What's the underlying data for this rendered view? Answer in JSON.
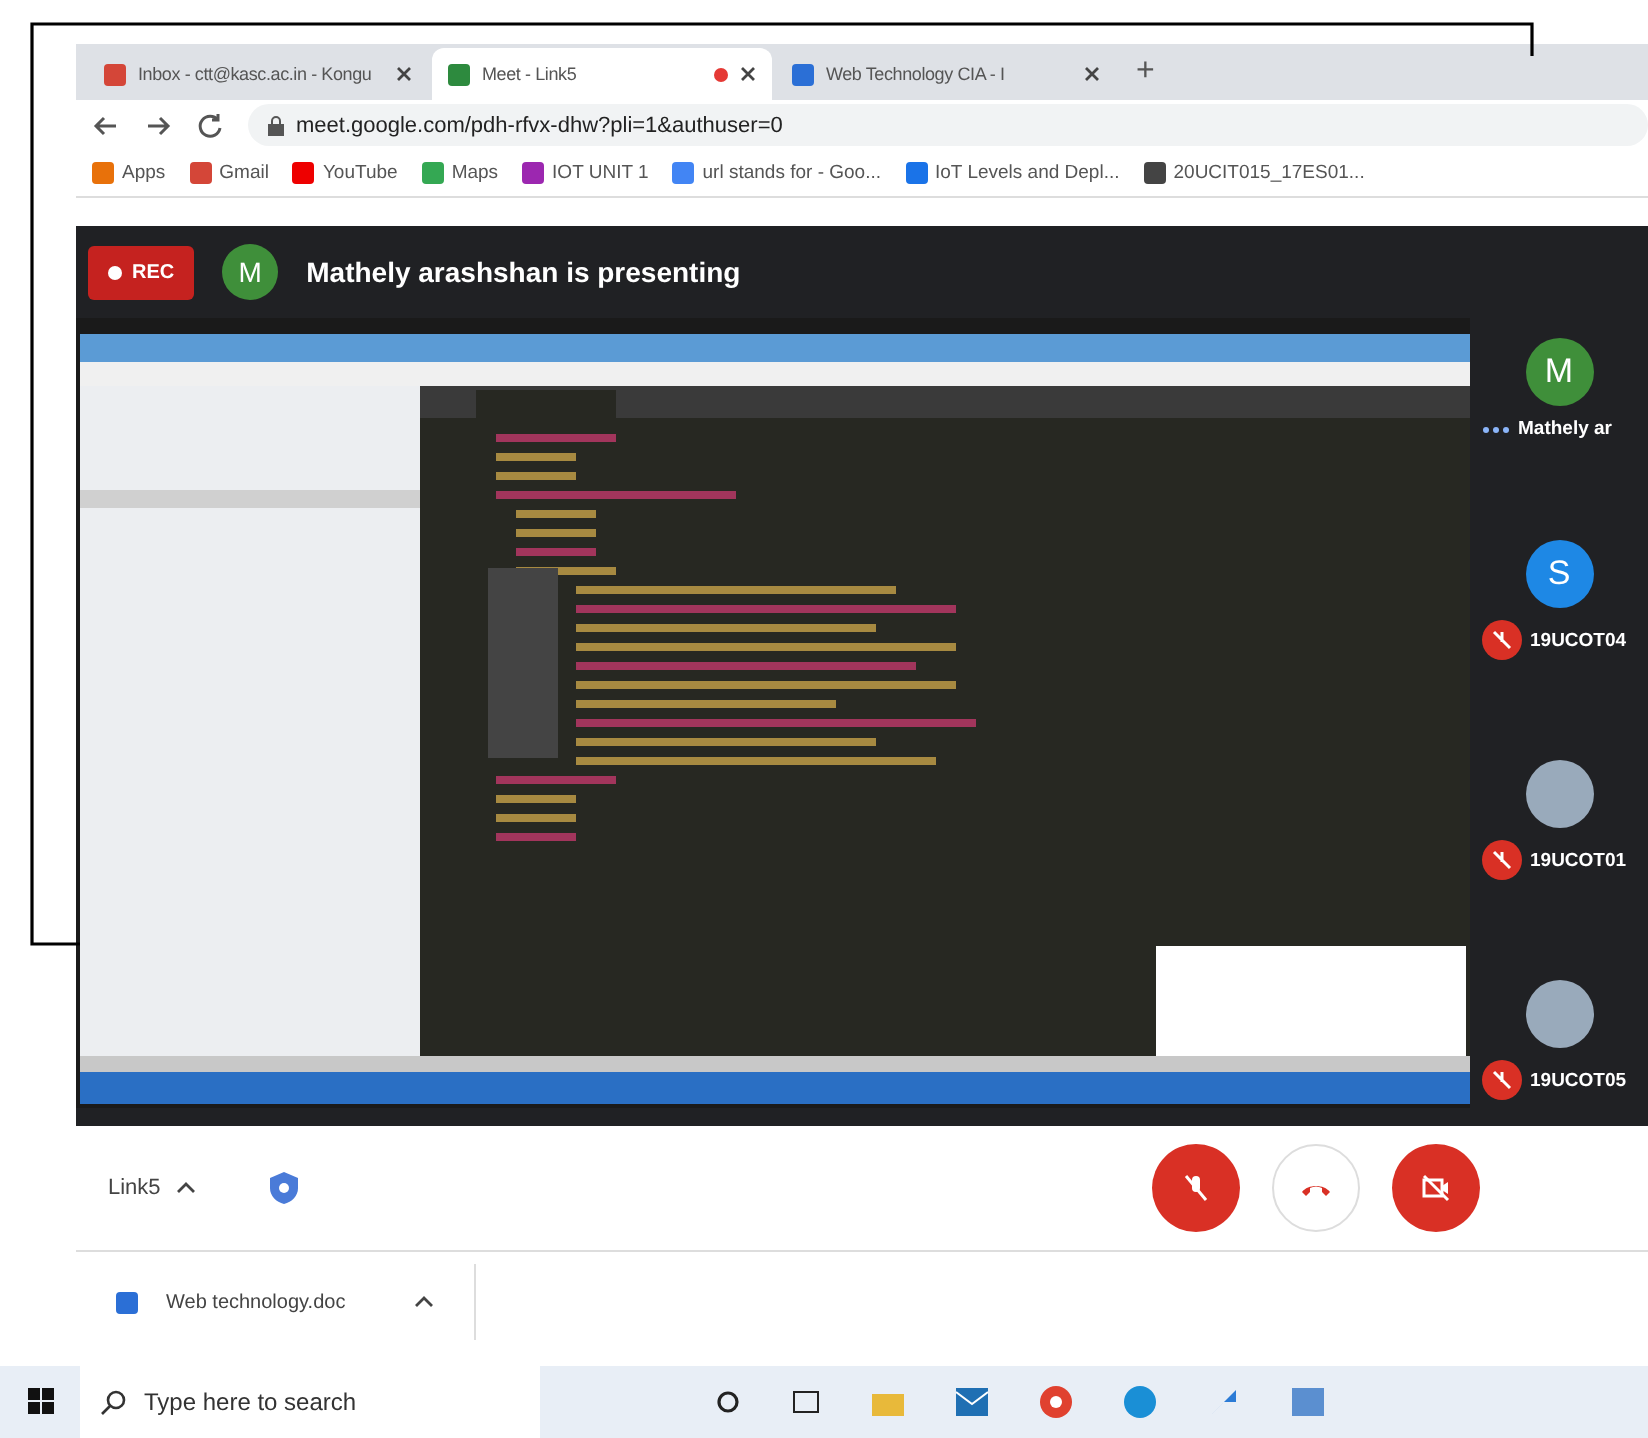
{
  "tabs": [
    {
      "title": "Inbox - ctt@kasc.ac.in - Kongu",
      "kind": "gmail",
      "selected": false,
      "recording": false
    },
    {
      "title": "Meet - Link5",
      "kind": "meet",
      "selected": true,
      "recording": true
    },
    {
      "title": "Web Technology CIA - I",
      "kind": "doc",
      "selected": false,
      "recording": false
    }
  ],
  "new_tab": "+",
  "address": "meet.google.com/pdh-rfvx-dhw?pli=1&authuser=0",
  "bookmarks": [
    {
      "label": "Apps",
      "kind": "apps"
    },
    {
      "label": "Gmail",
      "kind": "gmail"
    },
    {
      "label": "YouTube",
      "kind": "youtube"
    },
    {
      "label": "Maps",
      "kind": "maps"
    },
    {
      "label": "IOT UNIT 1",
      "kind": "wave"
    },
    {
      "label": "url stands for - Goo...",
      "kind": "google"
    },
    {
      "label": "IoT Levels and Depl...",
      "kind": "doc"
    },
    {
      "label": "20UCIT015_17ES01...",
      "kind": "globe"
    }
  ],
  "meet": {
    "rec": "REC",
    "presenter_initial": "M",
    "presenting": "Mathely arashshan is presenting",
    "participants": [
      {
        "name": "Mathely ar",
        "kind": "letter",
        "initial": "M",
        "color": "#3f8f3a",
        "muted": false
      },
      {
        "name": "19UCOT04",
        "kind": "letter",
        "initial": "S",
        "color": "#1e88e5",
        "muted": true
      },
      {
        "name": "19UCOT01",
        "kind": "photo",
        "muted": true
      },
      {
        "name": "19UCOT05",
        "kind": "photo",
        "muted": true
      }
    ],
    "meeting_name": "Link5",
    "mic_on": false,
    "camera_on": false
  },
  "downloads": [
    {
      "name": "Web technology.doc"
    }
  ],
  "taskbar": {
    "search_placeholder": "Type here to search"
  }
}
